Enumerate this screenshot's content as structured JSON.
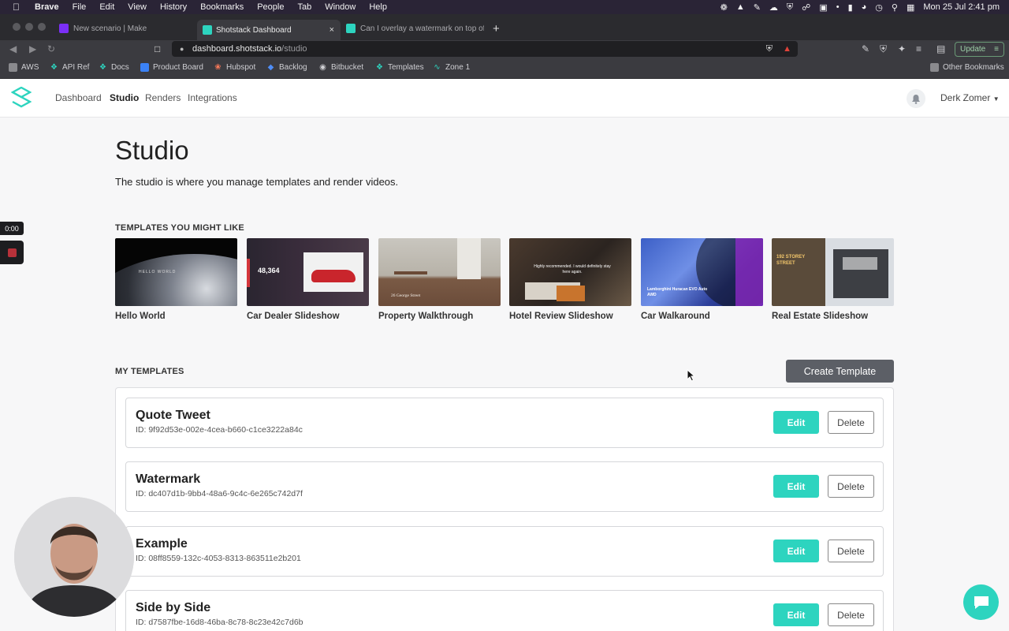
{
  "menubar": {
    "app": "Brave",
    "items": [
      "File",
      "Edit",
      "View",
      "History",
      "Bookmarks",
      "People",
      "Tab",
      "Window",
      "Help"
    ],
    "clock": "Mon 25 Jul  2:41 pm"
  },
  "browser": {
    "tabs": [
      {
        "label": "New scenario | Make",
        "active": false
      },
      {
        "label": "Shotstack Dashboard",
        "active": true
      },
      {
        "label": "Can I overlay a watermark on top of",
        "active": false
      }
    ],
    "url": {
      "domain": "dashboard.shotstack.io",
      "path": "/studio"
    },
    "update_label": "Update",
    "bookmarks": [
      "AWS",
      "API Ref",
      "Docs",
      "Product Board",
      "Hubspot",
      "Backlog",
      "Bitbucket",
      "Templates",
      "Zone 1"
    ],
    "other_bookmarks": "Other Bookmarks"
  },
  "nav": {
    "links": [
      "Dashboard",
      "Studio",
      "Renders",
      "Integrations"
    ],
    "active": "Studio",
    "user": "Derk Zomer"
  },
  "page": {
    "title": "Studio",
    "subtitle": "The studio is where you manage templates and render videos.",
    "suggested_heading": "TEMPLATES YOU MIGHT LIKE",
    "suggested": [
      {
        "caption": "Hello World",
        "overlay": "HELLO WORLD"
      },
      {
        "caption": "Car Dealer Slideshow",
        "overlay": "48,364"
      },
      {
        "caption": "Property Walkthrough",
        "overlay": "26 George Street"
      },
      {
        "caption": "Hotel Review Slideshow",
        "overlay": "Highly recommended. I would definitely stay here again."
      },
      {
        "caption": "Car Walkaround",
        "overlay": "Lamborghini Huracan EVO Auto AWD"
      },
      {
        "caption": "Real Estate Slideshow",
        "overlay": "192 STOREY STREET"
      }
    ],
    "my_templates_heading": "MY TEMPLATES",
    "create_button": "Create Template",
    "templates": [
      {
        "name": "Quote Tweet",
        "id": "ID: 9f92d53e-002e-4cea-b660-c1ce3222a84c"
      },
      {
        "name": "Watermark",
        "id": "ID: dc407d1b-9bb4-48a6-9c4c-6e265c742d7f"
      },
      {
        "name": "Example",
        "id": "ID: 08ff8559-132c-4053-8313-863511e2b201"
      },
      {
        "name": "Side by Side",
        "id": "ID: d7587fbe-16d8-46ba-8c78-8c23e42c7d6b"
      }
    ],
    "edit_label": "Edit",
    "delete_label": "Delete"
  },
  "recording": {
    "timer": "0:00"
  },
  "colors": {
    "accent": "#2dd4bf",
    "create_button": "#5c5f66"
  }
}
